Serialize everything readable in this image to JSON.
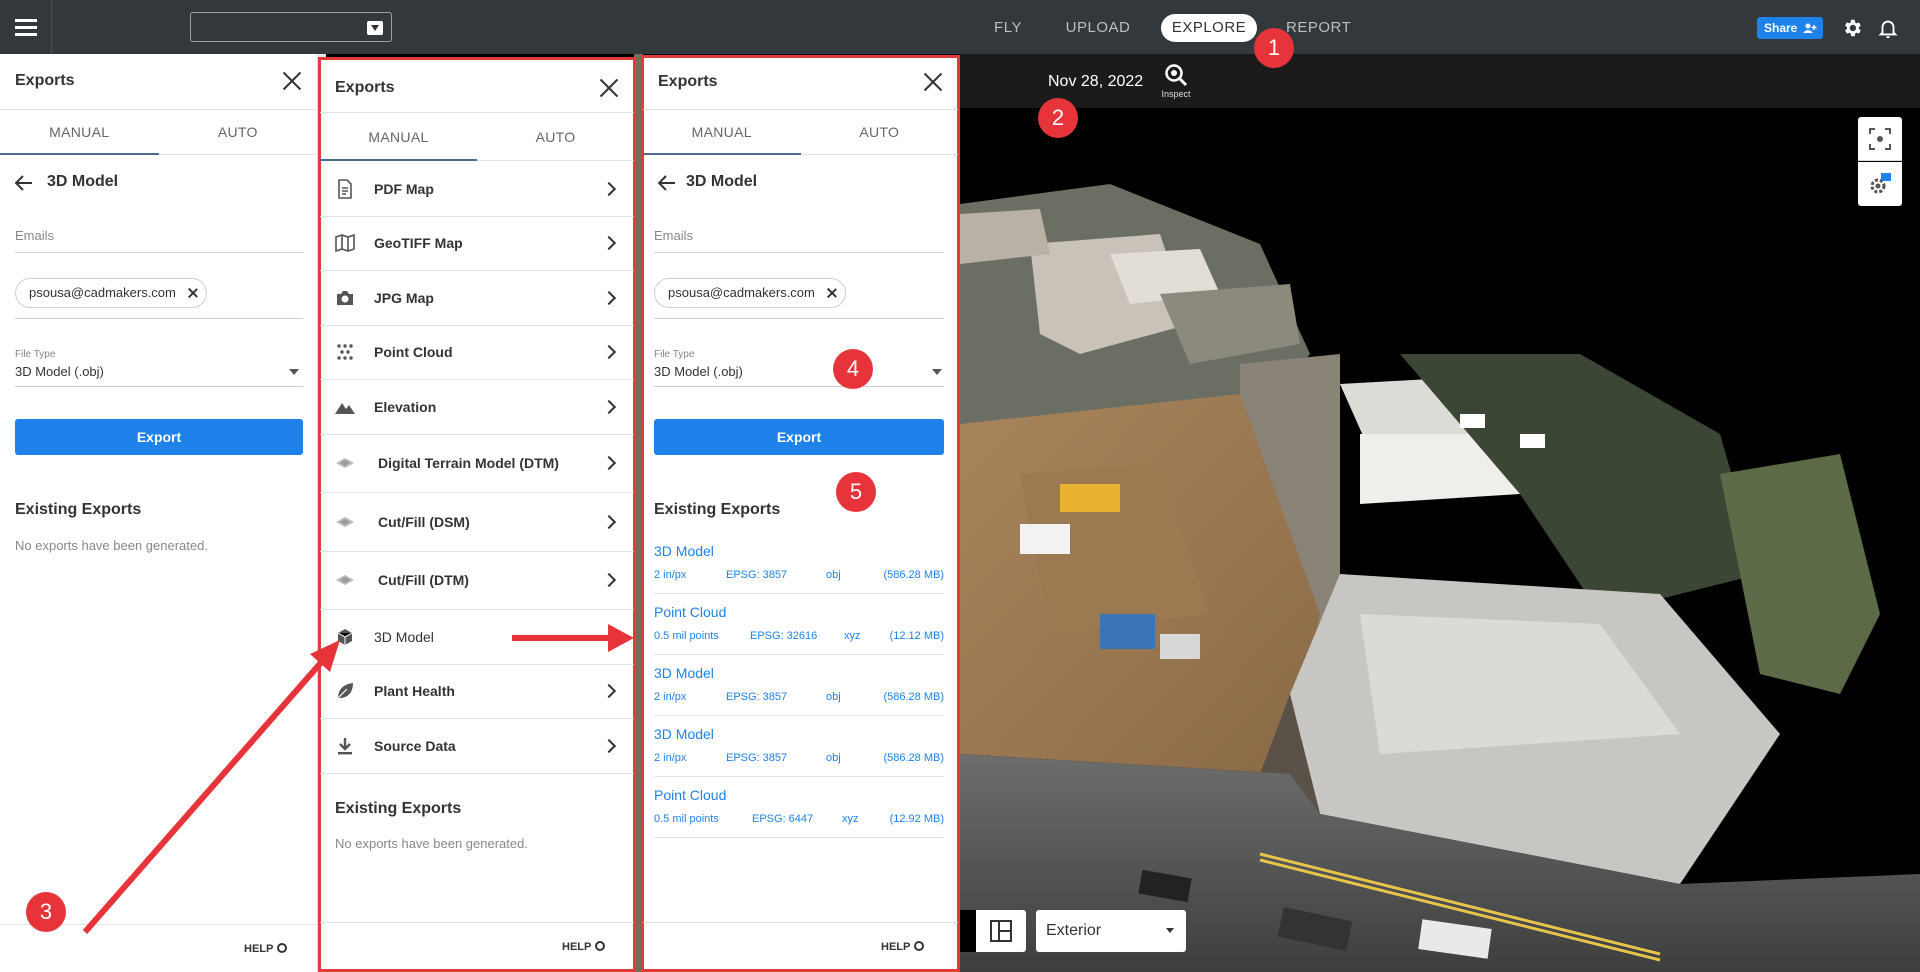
{
  "topbar": {
    "project_value": "",
    "nav": {
      "fly": "FLY",
      "upload": "UPLOAD",
      "explore": "EXPLORE",
      "report": "REPORT"
    },
    "share_label": "Share"
  },
  "map": {
    "date": "Nov 28, 2022",
    "inspect_label": "Inspect",
    "view_select": "Exterior",
    "settings_badge": "3D"
  },
  "left_panel": {
    "title": "Exports",
    "tabs": {
      "manual": "MANUAL",
      "auto": "AUTO"
    },
    "back_label": "3D Model",
    "emails_label": "Emails",
    "email_chip": "psousa@cadmakers.com",
    "file_type_label": "File Type",
    "file_type_value": "3D Model (.obj)",
    "export_button": "Export",
    "existing_heading": "Existing Exports",
    "empty_text": "No exports have been generated.",
    "help": "HELP"
  },
  "mid_panel": {
    "title": "Exports",
    "tabs": {
      "manual": "MANUAL",
      "auto": "AUTO"
    },
    "items": [
      {
        "label": "PDF Map",
        "icon": "pdf-doc-icon"
      },
      {
        "label": "GeoTIFF Map",
        "icon": "map-icon"
      },
      {
        "label": "JPG Map",
        "icon": "camera-icon"
      },
      {
        "label": "Point Cloud",
        "icon": "point-cloud-icon"
      },
      {
        "label": "Elevation",
        "icon": "mountain-icon"
      },
      {
        "label": "Digital Terrain Model (DTM)",
        "icon": "terrain-layer-icon"
      },
      {
        "label": "Cut/Fill (DSM)",
        "icon": "terrain-layer-icon"
      },
      {
        "label": "Cut/Fill (DTM)",
        "icon": "terrain-layer-icon"
      },
      {
        "label": "3D Model",
        "icon": "cube-icon"
      },
      {
        "label": "Plant Health",
        "icon": "leaf-icon"
      },
      {
        "label": "Source Data",
        "icon": "download-icon"
      }
    ],
    "existing_heading": "Existing Exports",
    "empty_text": "No exports have been generated.",
    "help": "HELP"
  },
  "right_panel": {
    "title": "Exports",
    "tabs": {
      "manual": "MANUAL",
      "auto": "AUTO"
    },
    "back_label": "3D Model",
    "emails_label": "Emails",
    "email_chip": "psousa@cadmakers.com",
    "file_type_label": "File Type",
    "file_type_value": "3D Model (.obj)",
    "export_button": "Export",
    "existing_heading": "Existing Exports",
    "exports": [
      {
        "name": "3D Model",
        "resolution": "2 in/px",
        "epsg": "EPSG: 3857",
        "format": "obj",
        "size": "(586.28 MB)"
      },
      {
        "name": "Point Cloud",
        "resolution": "0.5 mil points",
        "epsg": "EPSG: 32616",
        "format": "xyz",
        "size": "(12.12 MB)"
      },
      {
        "name": "3D Model",
        "resolution": "2 in/px",
        "epsg": "EPSG: 3857",
        "format": "obj",
        "size": "(586.28 MB)"
      },
      {
        "name": "3D Model",
        "resolution": "2 in/px",
        "epsg": "EPSG: 3857",
        "format": "obj",
        "size": "(586.28 MB)"
      },
      {
        "name": "Point Cloud",
        "resolution": "0.5 mil points",
        "epsg": "EPSG: 6447",
        "format": "xyz",
        "size": "(12.92 MB)"
      }
    ],
    "help": "HELP"
  },
  "annotations": {
    "badges": [
      "1",
      "2",
      "3",
      "4",
      "5"
    ],
    "color": "#e6343a"
  },
  "colors": {
    "accent": "#1e82ea",
    "topbar": "#33383c",
    "annotation": "#e6343a"
  }
}
